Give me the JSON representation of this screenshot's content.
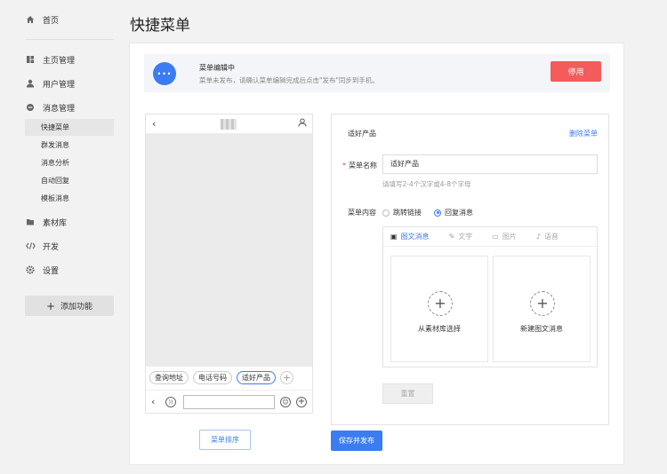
{
  "sidebar": {
    "home": "首页",
    "home_mgmt": "主页管理",
    "user_mgmt": "用户管理",
    "msg_mgmt": "消息管理",
    "sub_items": [
      "快捷菜单",
      "群发消息",
      "消息分析",
      "自动回复",
      "模板消息"
    ],
    "material": "素材库",
    "develop": "开发",
    "settings": "设置",
    "add_feature": "添加功能"
  },
  "page": {
    "title": "快捷菜单"
  },
  "notice": {
    "title": "菜单编辑中",
    "desc": "菜单未发布，请确认菜单编辑完成后点击\"发布\"同步到手机。",
    "stop_label": "停用"
  },
  "phone": {
    "menu_items": [
      "查询地址",
      "电话号码",
      "适好产品"
    ],
    "sort_label": "菜单排序"
  },
  "editor": {
    "title": "适好产品",
    "delete_label": "删除菜单",
    "name_label": "菜单名称",
    "name_value": "适好产品",
    "name_hint": "请填写2-4个汉字或4-8个字母",
    "content_label": "菜单内容",
    "radio_link": "跳转链接",
    "radio_reply": "回复消息",
    "tabs": [
      "图文消息",
      "文字",
      "图片",
      "语音"
    ],
    "choice_library": "从素材库选择",
    "choice_new": "新建图文消息",
    "reset_label": "重置"
  },
  "footer": {
    "save_label": "保存并发布"
  },
  "colors": {
    "accent": "#3b7cf2",
    "danger": "#f45b5b"
  }
}
